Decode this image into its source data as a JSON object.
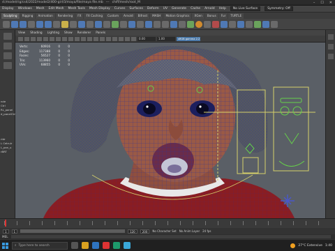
{
  "window": {
    "title_parts": [
      "d:/model/rig/cs4/2022/model2/400-girl/3/maya/file/maya file.mb",
      "---",
      "chiff/mesh/root_M"
    ],
    "controls": [
      "–",
      "☐",
      "✕"
    ]
  },
  "menubar": {
    "items": [
      "Display",
      "Windows",
      "Mesh",
      "Edit Mesh",
      "Mesh Tools",
      "Mesh Display",
      "Curves",
      "Surfaces",
      "Deform",
      "UV",
      "Generate",
      "Cache",
      "Arnold",
      "Help"
    ],
    "live_surface": "No Live Surface",
    "symmetry": "Symmetry: Off"
  },
  "shelf_tabs": [
    "Sculpting",
    "Rigging",
    "Animation",
    "Rendering",
    "FX",
    "FX Caching",
    "Custom",
    "Arnold",
    "Bifrost",
    "MASH",
    "Motion Graphics",
    "XGen",
    "Bonus",
    "Fur",
    "TURTLE"
  ],
  "active_shelf_tab": 0,
  "panel_menu": [
    "View",
    "Shading",
    "Lighting",
    "Show",
    "Renderer",
    "Panels"
  ],
  "panel_toolbar": {
    "field": "0.00",
    "field2": "1.00",
    "highlight": "sRGB gamma 2.2 (ACES)"
  },
  "hud": {
    "rows": [
      {
        "k": "Verts:",
        "v": "60916",
        "a": "0",
        "b": "0"
      },
      {
        "k": "Edges:",
        "v": "117388",
        "a": "0",
        "b": "0"
      },
      {
        "k": "Faces:",
        "v": "56527",
        "a": "0",
        "b": "0"
      },
      {
        "k": "Tris:",
        "v": "113960",
        "a": "0",
        "b": "0"
      },
      {
        "k": "UVs:",
        "v": "68855",
        "a": "0",
        "b": "0"
      }
    ]
  },
  "left_labels": [
    "nde",
    "Ctrl",
    "RL_panel",
    "d_panelCtrl",
    "rldr",
    "L Cetrulr",
    "L_pan_u",
    "rBRT"
  ],
  "range": {
    "start": "1",
    "in": "1",
    "out": "120",
    "end": "200",
    "fps": "24 fps",
    "character_set": "No Character Set",
    "anim_layer": "No Anim Layer"
  },
  "cmdline": {
    "label": "MEL"
  },
  "taskbar": {
    "search_placeholder": "Type here to search",
    "weather": "27°C Extensive",
    "time": "1:40"
  },
  "colors": {
    "viewport_bg": "#5a5f66",
    "wire_blue": "#2a2f9c",
    "control_yellow": "#d6d06a",
    "control_green": "#66d14a",
    "shirt_red": "#8a1d22",
    "skin": "#9a5a46"
  }
}
